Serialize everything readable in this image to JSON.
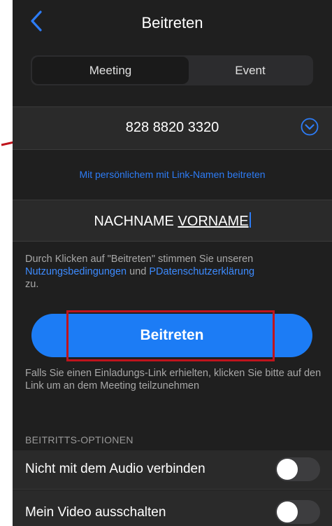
{
  "header": {
    "back_icon": "chevron-left-icon",
    "title": "Beitreten"
  },
  "tabs": [
    {
      "label": "Meeting",
      "active": true
    },
    {
      "label": "Event",
      "active": false
    }
  ],
  "meeting_id": {
    "value": "828 8820 3320",
    "dropdown_icon": "chevron-down-circle-icon"
  },
  "personal_link_text": "Mit persönlichem mit Link-Namen beitreten",
  "name_field": {
    "value_part1": "NACHNAME ",
    "value_part2": "VORNAME"
  },
  "terms": {
    "prefix": "Durch Klicken auf \"Beitreten\" stimmen Sie unseren ",
    "link1": "Nutzungsbedingungen",
    "middle": " und ",
    "link2": "PDatenschutzerklärung",
    "suffix": "zu."
  },
  "join_button": {
    "label": "Beitreten"
  },
  "hint_text": "Falls Sie einen Einladungs-Link erhielten, klicken Sie bitte auf den Link um an dem Meeting teilzunehmen",
  "options": {
    "section_title": "BEITRITTS-OPTIONEN",
    "items": [
      {
        "label": "Nicht mit dem Audio verbinden",
        "enabled": false
      },
      {
        "label": "Mein Video ausschalten",
        "enabled": false
      }
    ]
  },
  "colors": {
    "background": "#1f1f1f",
    "row": "#2a2a2a",
    "accent": "#1c7cf5",
    "link": "#3d8bff",
    "annotation": "#c0141c"
  }
}
